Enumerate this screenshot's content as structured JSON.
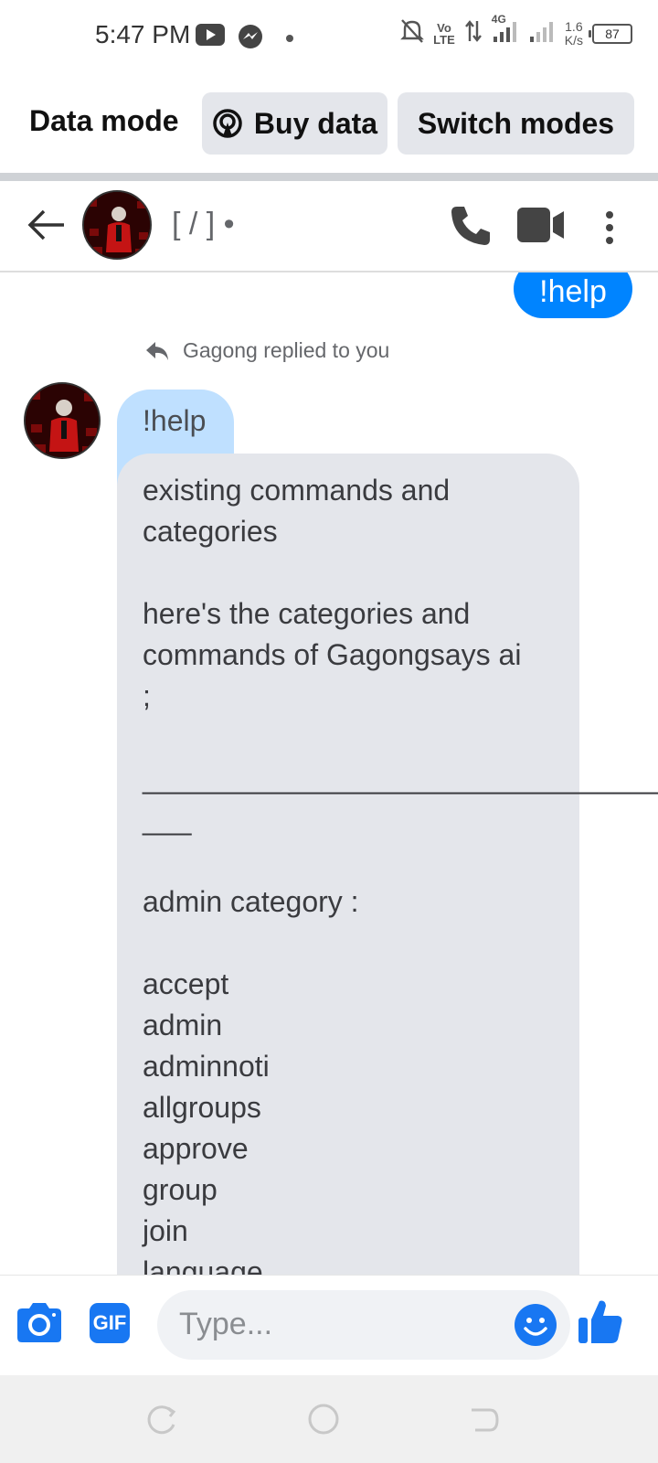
{
  "status_bar": {
    "time": "5:47 PM",
    "network_volte_top": "Vo",
    "network_volte_bottom": "LTE",
    "network_type": "4G",
    "speed_value": "1.6",
    "speed_unit": "K/s",
    "battery": "87"
  },
  "data_bar": {
    "title": "Data mode",
    "buy_label": "Buy data",
    "switch_label": "Switch modes"
  },
  "header": {
    "contact_name": "[ / ] •"
  },
  "chat": {
    "outgoing_message": "!help",
    "reply_note": "Gagong replied to you",
    "quoted_text": "!help",
    "incoming_message": "existing commands and\ncategories\n\nhere's the categories and\ncommands of Gagongsays ai\n;\n\n________________________________\n___\n\nadmin category :\n\naccept\nadmin\nadminnoti\nallgroups\napprove\ngroup\njoin\nlanguage"
  },
  "composer": {
    "placeholder": "Type...",
    "gif_label": "GIF"
  },
  "colors": {
    "messenger_blue": "#0084ff",
    "bubble_gray": "#e4e6eb",
    "reply_blue": "#bfe0ff"
  }
}
